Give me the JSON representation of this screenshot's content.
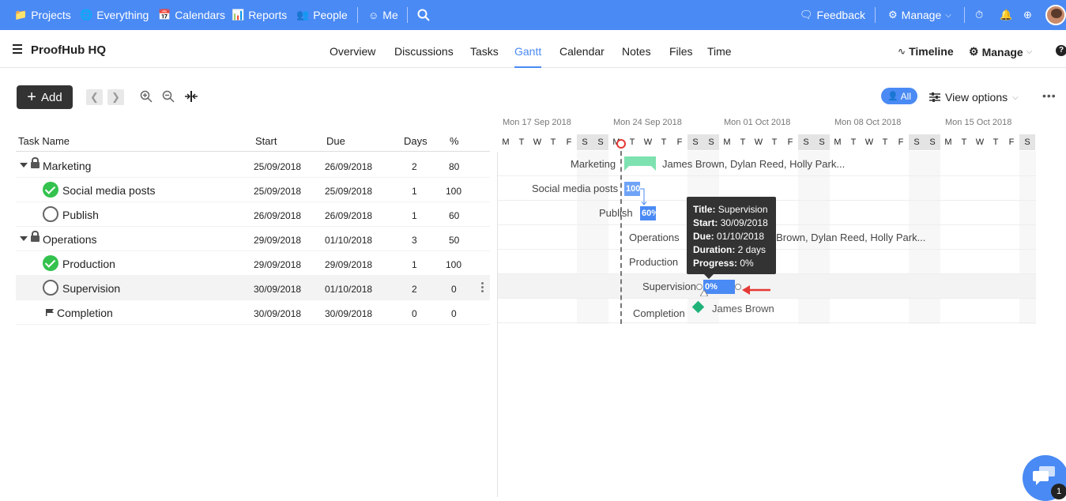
{
  "topbar": {
    "projects": "Projects",
    "everything": "Everything",
    "calendars": "Calendars",
    "reports": "Reports",
    "people": "People",
    "me": "Me",
    "feedback": "Feedback",
    "manage": "Manage"
  },
  "project": {
    "title": "ProofHub HQ"
  },
  "tabs": [
    "Overview",
    "Discussions",
    "Tasks",
    "Gantt",
    "Calendar",
    "Notes",
    "Files",
    "Time"
  ],
  "active_tab": "Gantt",
  "header_right": {
    "timeline": "Timeline",
    "manage": "Manage"
  },
  "toolbar": {
    "add": "Add",
    "all": "All",
    "view_options": "View options"
  },
  "table": {
    "headers": {
      "name": "Task Name",
      "start": "Start",
      "due": "Due",
      "days": "Days",
      "pct": "%"
    },
    "rows": [
      {
        "name": "Marketing",
        "start": "25/09/2018",
        "due": "26/09/2018",
        "days": "2",
        "pct": "80",
        "type": "group"
      },
      {
        "name": "Social media posts",
        "start": "25/09/2018",
        "due": "25/09/2018",
        "days": "1",
        "pct": "100",
        "type": "done"
      },
      {
        "name": "Publish",
        "start": "26/09/2018",
        "due": "26/09/2018",
        "days": "1",
        "pct": "60",
        "type": "open"
      },
      {
        "name": "Operations",
        "start": "29/09/2018",
        "due": "01/10/2018",
        "days": "3",
        "pct": "50",
        "type": "group"
      },
      {
        "name": "Production",
        "start": "29/09/2018",
        "due": "29/09/2018",
        "days": "1",
        "pct": "100",
        "type": "done"
      },
      {
        "name": "Supervision",
        "start": "30/09/2018",
        "due": "01/10/2018",
        "days": "2",
        "pct": "0",
        "type": "open"
      },
      {
        "name": "Completion",
        "start": "30/09/2018",
        "due": "30/09/2018",
        "days": "0",
        "pct": "0",
        "type": "milestone"
      }
    ]
  },
  "gantt": {
    "weeks": [
      "Mon 17 Sep 2018",
      "Mon 24 Sep 2018",
      "Mon 01 Oct 2018",
      "Mon 08 Oct 2018",
      "Mon 15 Oct 2018"
    ],
    "day_letters": [
      "M",
      "T",
      "W",
      "T",
      "F",
      "S",
      "S",
      "M",
      "T",
      "W",
      "T",
      "F",
      "S",
      "S",
      "M",
      "T",
      "W",
      "T",
      "F",
      "S",
      "S",
      "M",
      "T",
      "W",
      "T",
      "F",
      "S",
      "S",
      "M",
      "T",
      "W",
      "T",
      "F",
      "S"
    ],
    "labels": {
      "marketing": "Marketing",
      "marketing_assignees": "James Brown, Dylan Reed, Holly Park...",
      "social": "Social media posts",
      "social_bar": "100",
      "publish": "Publish",
      "publish_bar": "60%",
      "operations": "Operations",
      "operations_assignees": "s Brown, Dylan Reed, Holly Park...",
      "production": "Production",
      "supervision": "Supervision",
      "supervision_bar": "0%",
      "completion": "Completion",
      "completion_assignee": "James Brown"
    },
    "tooltip": {
      "title_label": "Title:",
      "title": "Supervision",
      "start_label": "Start:",
      "start": "30/09/2018",
      "due_label": "Due:",
      "due": "01/10/2018",
      "duration_label": "Duration:",
      "duration": "2 days",
      "progress_label": "Progress:",
      "progress": "0%"
    }
  },
  "chat": {
    "badge": "1"
  },
  "colors": {
    "brand": "#4a8af4",
    "done": "#33c24d",
    "milestone": "#1fb37a",
    "today": "#e53935"
  }
}
